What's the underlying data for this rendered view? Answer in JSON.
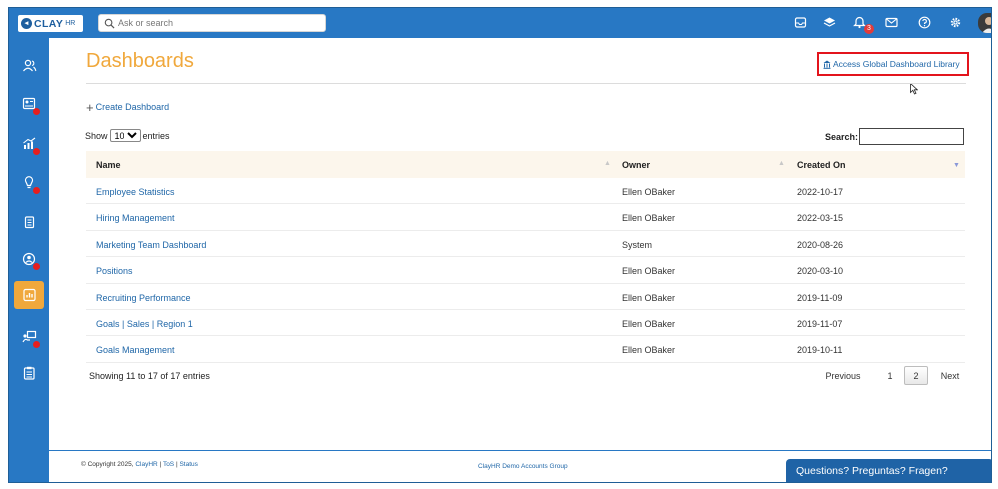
{
  "topbar": {
    "logo_text": "CLAY",
    "logo_sub": "HR",
    "search_placeholder": "Ask or search",
    "notification_count": "3"
  },
  "main": {
    "title": "Dashboards",
    "library_link": "Access Global Dashboard Library",
    "create_label": "Create Dashboard",
    "show_label": "Show",
    "entries_label": "entries",
    "page_size": "10",
    "page_size_options": [
      "10"
    ],
    "search_label": "Search:",
    "columns": [
      "Name",
      "Owner",
      "Created On"
    ],
    "rows": [
      {
        "name": "Employee Statistics",
        "owner": "Ellen OBaker",
        "created": "2022-10-17"
      },
      {
        "name": "Hiring Management",
        "owner": "Ellen OBaker",
        "created": "2022-03-15"
      },
      {
        "name": "Marketing Team Dashboard",
        "owner": "System",
        "created": "2020-08-26"
      },
      {
        "name": "Positions",
        "owner": "Ellen OBaker",
        "created": "2020-03-10"
      },
      {
        "name": "Recruiting Performance",
        "owner": "Ellen OBaker",
        "created": "2019-11-09"
      },
      {
        "name": "Goals | Sales | Region 1",
        "owner": "Ellen OBaker",
        "created": "2019-11-07"
      },
      {
        "name": "Goals Management",
        "owner": "Ellen OBaker",
        "created": "2019-10-11"
      }
    ],
    "info": "Showing 11 to 17 of 17 entries",
    "pagination": {
      "previous": "Previous",
      "page1": "1",
      "page2": "2",
      "next": "Next"
    }
  },
  "footer": {
    "copyright": "© Copyright 2025,",
    "link_clayhr": "ClayHR",
    "sep": "|",
    "link_tos": "ToS",
    "link_status": "Status",
    "group": "ClayHR Demo Accounts Group",
    "chat": "Questions? Preguntas? Fragen?"
  },
  "colors": {
    "primary": "#2878c4",
    "accent": "#f0a83c",
    "link": "#2067a8",
    "highlight_border": "#e3141c",
    "badge": "#e23b3b"
  },
  "icons": {
    "topbar": [
      "inbox-icon",
      "layers-icon",
      "bell-icon",
      "mail-icon",
      "help-icon",
      "settings-icon"
    ],
    "sidebar": [
      "people-icon",
      "id-card-icon",
      "chart-growth-icon",
      "lightbulb-icon",
      "documents-icon",
      "person-circle-icon",
      "dashboard-icon",
      "board-meeting-icon",
      "clipboard-icon"
    ]
  }
}
